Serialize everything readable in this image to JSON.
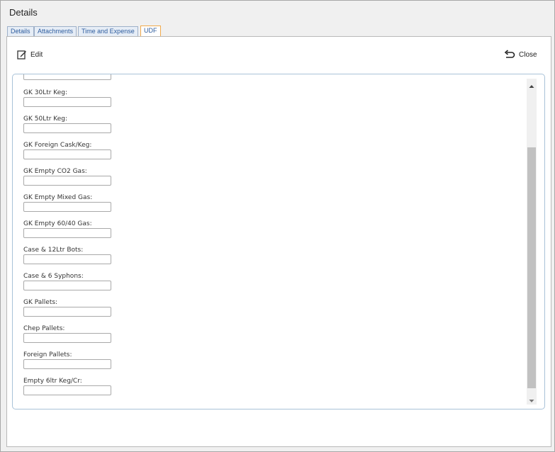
{
  "window": {
    "title": "Details"
  },
  "tabs": [
    {
      "label": "Details"
    },
    {
      "label": "Attachments"
    },
    {
      "label": "Time and Expense"
    },
    {
      "label": "UDF",
      "active": true
    }
  ],
  "toolbar": {
    "edit_label": "Edit",
    "close_label": "Close"
  },
  "form": {
    "fields": [
      {
        "label": "GK 30Ltr Keg:",
        "value": ""
      },
      {
        "label": "GK 50Ltr Keg:",
        "value": ""
      },
      {
        "label": "GK Foreign Cask/Keg:",
        "value": ""
      },
      {
        "label": "GK Empty CO2 Gas:",
        "value": ""
      },
      {
        "label": "GK Empty Mixed Gas:",
        "value": ""
      },
      {
        "label": "GK Empty 60/40 Gas:",
        "value": ""
      },
      {
        "label": "Case & 12Ltr Bots:",
        "value": ""
      },
      {
        "label": "Case & 6 Syphons:",
        "value": ""
      },
      {
        "label": "GK Pallets:",
        "value": ""
      },
      {
        "label": "Chep Pallets:",
        "value": ""
      },
      {
        "label": "Foreign Pallets:",
        "value": ""
      },
      {
        "label": "Empty 6ltr Keg/Cr:",
        "value": ""
      }
    ]
  },
  "colors": {
    "tab_text": "#2d5c9e",
    "active_tab_border": "#f0a94b",
    "form_border": "#a9c2d8",
    "scroll_thumb": "#c1c1c1"
  },
  "icons": {
    "edit": "edit-icon",
    "close": "undo-arrow-icon",
    "scroll_up": "triangle-up-icon",
    "scroll_down": "triangle-down-icon"
  }
}
